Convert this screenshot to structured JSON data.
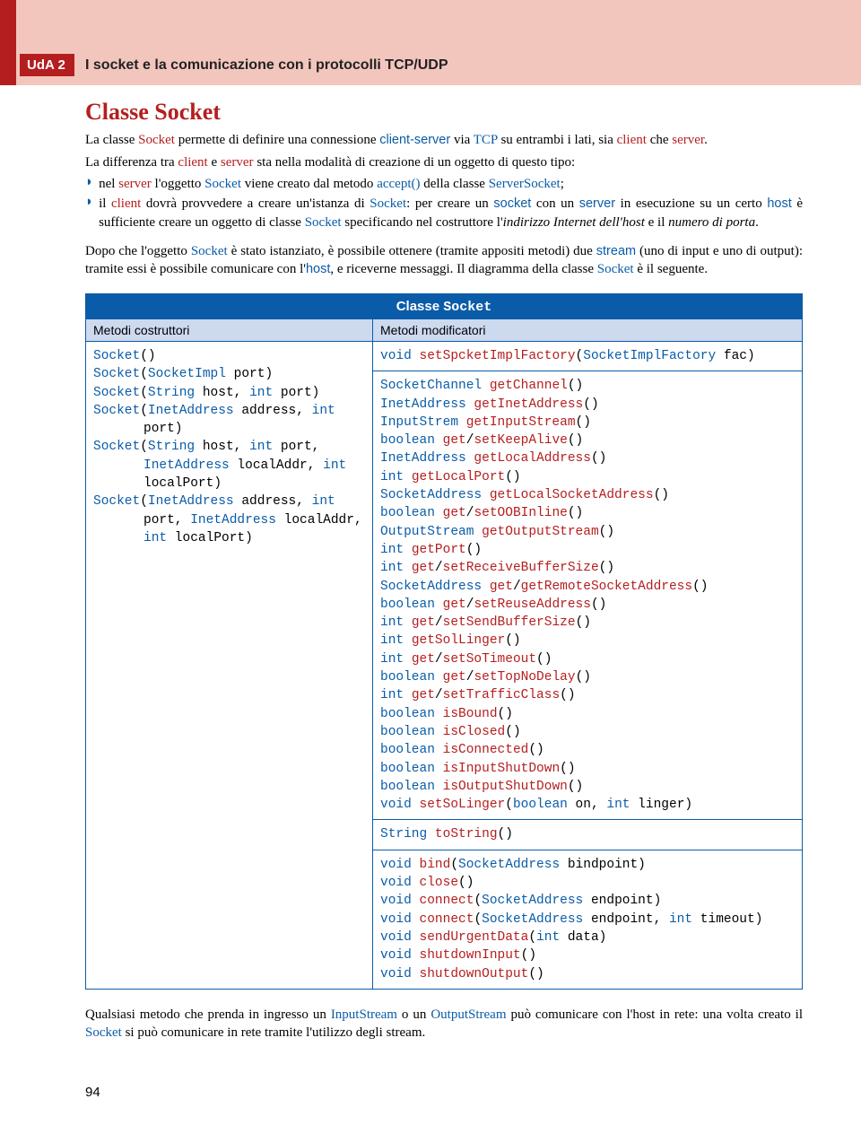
{
  "uda": "UdA 2",
  "header_title": "I socket e la comunicazione con i protocolli TCP/UDP",
  "h1": "Classe Socket",
  "para1_parts": [
    {
      "t": "La classe ",
      "c": ""
    },
    {
      "t": "Socket",
      "c": "red"
    },
    {
      "t": " permette di definire una connessione ",
      "c": ""
    },
    {
      "t": "client-server",
      "c": "sans-blue"
    },
    {
      "t": " via ",
      "c": ""
    },
    {
      "t": "TCP",
      "c": "blue"
    },
    {
      "t": " su entrambi i lati, sia ",
      "c": ""
    },
    {
      "t": "client",
      "c": "red"
    },
    {
      "t": " che ",
      "c": ""
    },
    {
      "t": "server",
      "c": "red"
    },
    {
      "t": ".",
      "c": ""
    }
  ],
  "para2": "La differenza tra ",
  "para2_parts": [
    {
      "t": "La differenza tra ",
      "c": ""
    },
    {
      "t": "client",
      "c": "red"
    },
    {
      "t": " e ",
      "c": ""
    },
    {
      "t": "server",
      "c": "red"
    },
    {
      "t": " sta nella modalità di creazione di un oggetto di questo tipo:",
      "c": ""
    }
  ],
  "bullet1_parts": [
    {
      "t": "nel ",
      "c": ""
    },
    {
      "t": "server",
      "c": "red"
    },
    {
      "t": " l'oggetto ",
      "c": ""
    },
    {
      "t": "Socket",
      "c": "blue"
    },
    {
      "t": " viene creato dal metodo ",
      "c": ""
    },
    {
      "t": "accept()",
      "c": "blue"
    },
    {
      "t": " della classe ",
      "c": ""
    },
    {
      "t": "ServerSocket",
      "c": "blue"
    },
    {
      "t": ";",
      "c": ""
    }
  ],
  "bullet2_parts": [
    {
      "t": "il ",
      "c": ""
    },
    {
      "t": "client",
      "c": "red"
    },
    {
      "t": " dovrà provvedere a creare un'istanza di ",
      "c": ""
    },
    {
      "t": "Socket",
      "c": "blue"
    },
    {
      "t": ": per creare un ",
      "c": ""
    },
    {
      "t": "socket",
      "c": "sans-blue"
    },
    {
      "t": " con un ",
      "c": ""
    },
    {
      "t": "server",
      "c": "sans-blue"
    },
    {
      "t": " in esecuzione su un certo ",
      "c": ""
    },
    {
      "t": "host",
      "c": "sans-blue"
    },
    {
      "t": " è sufficiente creare un oggetto di classe ",
      "c": ""
    },
    {
      "t": "Socket",
      "c": "blue"
    },
    {
      "t": " specificando nel costruttore l'",
      "c": ""
    },
    {
      "t": "indirizzo Internet dell'host",
      "c": "it"
    },
    {
      "t": " e il ",
      "c": ""
    },
    {
      "t": "numero di porta",
      "c": "it"
    },
    {
      "t": ".",
      "c": ""
    }
  ],
  "para3_parts": [
    {
      "t": "Dopo che l'oggetto ",
      "c": ""
    },
    {
      "t": "Socket",
      "c": "blue"
    },
    {
      "t": " è stato istanziato, è possibile ottenere (tramite appositi metodi) due ",
      "c": ""
    },
    {
      "t": "stream",
      "c": "sans-blue"
    },
    {
      "t": " (uno di input e uno di output): tramite essi è possibile comunicare con l'",
      "c": ""
    },
    {
      "t": "host",
      "c": "sans-blue"
    },
    {
      "t": ", e riceverne messaggi. Il diagramma della classe ",
      "c": ""
    },
    {
      "t": "Socket",
      "c": "blue"
    },
    {
      "t": " è il seguente.",
      "c": ""
    }
  ],
  "table": {
    "title_prefix": "Classe ",
    "title_mono": "Socket",
    "left_head": "Metodi costruttori",
    "right_head": "Metodi modificatori",
    "constructors": [
      [
        {
          "t": "Socket",
          "c": "tp"
        },
        {
          "t": "()",
          "c": "k"
        }
      ],
      [
        {
          "t": "Socket",
          "c": "tp"
        },
        {
          "t": "(",
          "c": "k"
        },
        {
          "t": "SocketImpl",
          "c": "tp"
        },
        {
          "t": " port)",
          "c": "k"
        }
      ],
      [
        {
          "t": "Socket",
          "c": "tp"
        },
        {
          "t": "(",
          "c": "k"
        },
        {
          "t": "String",
          "c": "tp"
        },
        {
          "t": " host, ",
          "c": "k"
        },
        {
          "t": "int",
          "c": "tp"
        },
        {
          "t": " port)",
          "c": "k"
        }
      ],
      [
        {
          "t": "Socket",
          "c": "tp"
        },
        {
          "t": "(",
          "c": "k"
        },
        {
          "t": "InetAddress",
          "c": "tp"
        },
        {
          "t": " address, ",
          "c": "k"
        },
        {
          "t": "int",
          "c": "tp"
        }
      ],
      [
        {
          "t": "port)",
          "c": "k",
          "indent": true
        }
      ],
      [
        {
          "t": "Socket",
          "c": "tp"
        },
        {
          "t": "(",
          "c": "k"
        },
        {
          "t": "String",
          "c": "tp"
        },
        {
          "t": " host, ",
          "c": "k"
        },
        {
          "t": "int",
          "c": "tp"
        },
        {
          "t": " port,",
          "c": "k"
        }
      ],
      [
        {
          "t": "InetAddress",
          "c": "tp",
          "indent": true
        },
        {
          "t": " localAddr, ",
          "c": "k"
        },
        {
          "t": "int",
          "c": "tp"
        }
      ],
      [
        {
          "t": "localPort)",
          "c": "k",
          "indent": true
        }
      ],
      [
        {
          "t": "Socket",
          "c": "tp"
        },
        {
          "t": "(",
          "c": "k"
        },
        {
          "t": "InetAddress",
          "c": "tp"
        },
        {
          "t": " address, ",
          "c": "k"
        },
        {
          "t": "int",
          "c": "tp"
        }
      ],
      [
        {
          "t": "port, ",
          "c": "k",
          "indent": true
        },
        {
          "t": "InetAddress",
          "c": "tp"
        },
        {
          "t": " localAddr,",
          "c": "k"
        }
      ],
      [
        {
          "t": "int",
          "c": "tp",
          "indent": true
        },
        {
          "t": " localPort)",
          "c": "k"
        }
      ]
    ],
    "mod_group1": [
      [
        {
          "t": "void",
          "c": "tp"
        },
        {
          "t": " ",
          "c": "k"
        },
        {
          "t": "setSpcketImplFactory",
          "c": "fn"
        },
        {
          "t": "(",
          "c": "k"
        },
        {
          "t": "SocketImplFactory",
          "c": "tp"
        },
        {
          "t": " fac)",
          "c": "k"
        }
      ]
    ],
    "mod_group2": [
      [
        {
          "t": "SocketChannel",
          "c": "tp"
        },
        {
          "t": " ",
          "c": "k"
        },
        {
          "t": "getChannel",
          "c": "fn"
        },
        {
          "t": "()",
          "c": "k"
        }
      ],
      [
        {
          "t": "InetAddress",
          "c": "tp"
        },
        {
          "t": " ",
          "c": "k"
        },
        {
          "t": "getInetAddress",
          "c": "fn"
        },
        {
          "t": "()",
          "c": "k"
        }
      ],
      [
        {
          "t": "InputStrem",
          "c": "tp"
        },
        {
          "t": " ",
          "c": "k"
        },
        {
          "t": "getInputStream",
          "c": "fn"
        },
        {
          "t": "()",
          "c": "k"
        }
      ],
      [
        {
          "t": "boolean",
          "c": "tp"
        },
        {
          "t": " ",
          "c": "k"
        },
        {
          "t": "get",
          "c": "fn"
        },
        {
          "t": "/",
          "c": "k"
        },
        {
          "t": "setKeepAlive",
          "c": "fn"
        },
        {
          "t": "()",
          "c": "k"
        }
      ],
      [
        {
          "t": "InetAddress",
          "c": "tp"
        },
        {
          "t": " ",
          "c": "k"
        },
        {
          "t": "getLocalAddress",
          "c": "fn"
        },
        {
          "t": "()",
          "c": "k"
        }
      ],
      [
        {
          "t": "int",
          "c": "tp"
        },
        {
          "t": " ",
          "c": "k"
        },
        {
          "t": "getLocalPort",
          "c": "fn"
        },
        {
          "t": "()",
          "c": "k"
        }
      ],
      [
        {
          "t": "SocketAddress",
          "c": "tp"
        },
        {
          "t": " ",
          "c": "k"
        },
        {
          "t": "getLocalSocketAddress",
          "c": "fn"
        },
        {
          "t": "()",
          "c": "k"
        }
      ],
      [
        {
          "t": "boolean",
          "c": "tp"
        },
        {
          "t": " ",
          "c": "k"
        },
        {
          "t": "get",
          "c": "fn"
        },
        {
          "t": "/",
          "c": "k"
        },
        {
          "t": "setOOBInline",
          "c": "fn"
        },
        {
          "t": "()",
          "c": "k"
        }
      ],
      [
        {
          "t": "OutputStream",
          "c": "tp"
        },
        {
          "t": " ",
          "c": "k"
        },
        {
          "t": "getOutputStream",
          "c": "fn"
        },
        {
          "t": "()",
          "c": "k"
        }
      ],
      [
        {
          "t": "int",
          "c": "tp"
        },
        {
          "t": " ",
          "c": "k"
        },
        {
          "t": "getPort",
          "c": "fn"
        },
        {
          "t": "()",
          "c": "k"
        }
      ],
      [
        {
          "t": "int",
          "c": "tp"
        },
        {
          "t": " ",
          "c": "k"
        },
        {
          "t": "get",
          "c": "fn"
        },
        {
          "t": "/",
          "c": "k"
        },
        {
          "t": "setReceiveBufferSize",
          "c": "fn"
        },
        {
          "t": "()",
          "c": "k"
        }
      ],
      [
        {
          "t": "SocketAddress",
          "c": "tp"
        },
        {
          "t": " ",
          "c": "k"
        },
        {
          "t": "get",
          "c": "fn"
        },
        {
          "t": "/",
          "c": "k"
        },
        {
          "t": "getRemoteSocketAddress",
          "c": "fn"
        },
        {
          "t": "()",
          "c": "k"
        }
      ],
      [
        {
          "t": "boolean",
          "c": "tp"
        },
        {
          "t": " ",
          "c": "k"
        },
        {
          "t": "get",
          "c": "fn"
        },
        {
          "t": "/",
          "c": "k"
        },
        {
          "t": "setReuseAddress",
          "c": "fn"
        },
        {
          "t": "()",
          "c": "k"
        }
      ],
      [
        {
          "t": "int",
          "c": "tp"
        },
        {
          "t": " ",
          "c": "k"
        },
        {
          "t": "get",
          "c": "fn"
        },
        {
          "t": "/",
          "c": "k"
        },
        {
          "t": "setSendBufferSize",
          "c": "fn"
        },
        {
          "t": "()",
          "c": "k"
        }
      ],
      [
        {
          "t": "int",
          "c": "tp"
        },
        {
          "t": " ",
          "c": "k"
        },
        {
          "t": "getSolLinger",
          "c": "fn"
        },
        {
          "t": "()",
          "c": "k"
        }
      ],
      [
        {
          "t": "int",
          "c": "tp"
        },
        {
          "t": " ",
          "c": "k"
        },
        {
          "t": "get",
          "c": "fn"
        },
        {
          "t": "/",
          "c": "k"
        },
        {
          "t": "setSoTimeout",
          "c": "fn"
        },
        {
          "t": "()",
          "c": "k"
        }
      ],
      [
        {
          "t": "boolean",
          "c": "tp"
        },
        {
          "t": " ",
          "c": "k"
        },
        {
          "t": "get",
          "c": "fn"
        },
        {
          "t": "/",
          "c": "k"
        },
        {
          "t": "setTopNoDelay",
          "c": "fn"
        },
        {
          "t": "()",
          "c": "k"
        }
      ],
      [
        {
          "t": "int",
          "c": "tp"
        },
        {
          "t": " ",
          "c": "k"
        },
        {
          "t": "get",
          "c": "fn"
        },
        {
          "t": "/",
          "c": "k"
        },
        {
          "t": "setTrafficClass",
          "c": "fn"
        },
        {
          "t": "()",
          "c": "k"
        }
      ],
      [
        {
          "t": "boolean",
          "c": "tp"
        },
        {
          "t": " ",
          "c": "k"
        },
        {
          "t": "isBound",
          "c": "fn"
        },
        {
          "t": "()",
          "c": "k"
        }
      ],
      [
        {
          "t": "boolean",
          "c": "tp"
        },
        {
          "t": " ",
          "c": "k"
        },
        {
          "t": "isClosed",
          "c": "fn"
        },
        {
          "t": "()",
          "c": "k"
        }
      ],
      [
        {
          "t": "boolean",
          "c": "tp"
        },
        {
          "t": " ",
          "c": "k"
        },
        {
          "t": "isConnected",
          "c": "fn"
        },
        {
          "t": "()",
          "c": "k"
        }
      ],
      [
        {
          "t": "boolean",
          "c": "tp"
        },
        {
          "t": " ",
          "c": "k"
        },
        {
          "t": "isInputShutDown",
          "c": "fn"
        },
        {
          "t": "()",
          "c": "k"
        }
      ],
      [
        {
          "t": "boolean",
          "c": "tp"
        },
        {
          "t": " ",
          "c": "k"
        },
        {
          "t": "isOutputShutDown",
          "c": "fn"
        },
        {
          "t": "()",
          "c": "k"
        }
      ],
      [
        {
          "t": "void",
          "c": "tp"
        },
        {
          "t": " ",
          "c": "k"
        },
        {
          "t": "setSoLinger",
          "c": "fn"
        },
        {
          "t": "(",
          "c": "k"
        },
        {
          "t": "boolean",
          "c": "tp"
        },
        {
          "t": " on, ",
          "c": "k"
        },
        {
          "t": "int",
          "c": "tp"
        },
        {
          "t": " linger)",
          "c": "k"
        }
      ]
    ],
    "mod_group3": [
      [
        {
          "t": "String",
          "c": "tp"
        },
        {
          "t": " ",
          "c": "k"
        },
        {
          "t": "toString",
          "c": "fn"
        },
        {
          "t": "()",
          "c": "k"
        }
      ]
    ],
    "mod_group4": [
      [
        {
          "t": "void",
          "c": "tp"
        },
        {
          "t": " ",
          "c": "k"
        },
        {
          "t": "bind",
          "c": "fn"
        },
        {
          "t": "(",
          "c": "k"
        },
        {
          "t": "SocketAddress",
          "c": "tp"
        },
        {
          "t": " bindpoint)",
          "c": "k"
        }
      ],
      [
        {
          "t": "void",
          "c": "tp"
        },
        {
          "t": " ",
          "c": "k"
        },
        {
          "t": "close",
          "c": "fn"
        },
        {
          "t": "()",
          "c": "k"
        }
      ],
      [
        {
          "t": "void",
          "c": "tp"
        },
        {
          "t": " ",
          "c": "k"
        },
        {
          "t": "connect",
          "c": "fn"
        },
        {
          "t": "(",
          "c": "k"
        },
        {
          "t": "SocketAddress",
          "c": "tp"
        },
        {
          "t": " endpoint)",
          "c": "k"
        }
      ],
      [
        {
          "t": "void",
          "c": "tp"
        },
        {
          "t": " ",
          "c": "k"
        },
        {
          "t": "connect",
          "c": "fn"
        },
        {
          "t": "(",
          "c": "k"
        },
        {
          "t": "SocketAddress",
          "c": "tp"
        },
        {
          "t": " endpoint, ",
          "c": "k"
        },
        {
          "t": "int",
          "c": "tp"
        },
        {
          "t": " timeout)",
          "c": "k"
        }
      ],
      [
        {
          "t": "void",
          "c": "tp"
        },
        {
          "t": " ",
          "c": "k"
        },
        {
          "t": "sendUrgentData",
          "c": "fn"
        },
        {
          "t": "(",
          "c": "k"
        },
        {
          "t": "int",
          "c": "tp"
        },
        {
          "t": " data)",
          "c": "k"
        }
      ],
      [
        {
          "t": "void",
          "c": "tp"
        },
        {
          "t": " ",
          "c": "k"
        },
        {
          "t": "shutdownInput",
          "c": "fn"
        },
        {
          "t": "()",
          "c": "k"
        }
      ],
      [
        {
          "t": "void",
          "c": "tp"
        },
        {
          "t": " ",
          "c": "k"
        },
        {
          "t": "shutdownOutput",
          "c": "fn"
        },
        {
          "t": "()",
          "c": "k"
        }
      ]
    ]
  },
  "para4_parts": [
    {
      "t": "Qualsiasi metodo che prenda in ingresso un ",
      "c": ""
    },
    {
      "t": "InputStream",
      "c": "blue"
    },
    {
      "t": " o un ",
      "c": ""
    },
    {
      "t": "OutputStream",
      "c": "blue"
    },
    {
      "t": " può comunicare con l'host in rete: una volta creato il ",
      "c": ""
    },
    {
      "t": "Socket",
      "c": "blue"
    },
    {
      "t": " si può comunicare in rete tramite l'utilizzo degli stream.",
      "c": ""
    }
  ],
  "page_num": "94"
}
